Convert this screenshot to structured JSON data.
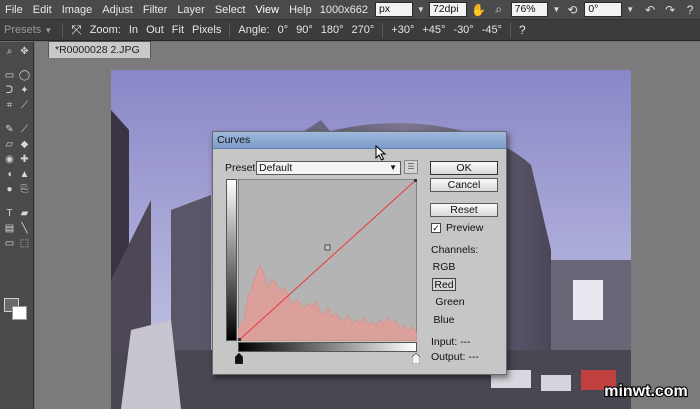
{
  "menu": [
    "File",
    "Edit",
    "Image",
    "Adjust",
    "Filter",
    "Layer",
    "Select",
    "View",
    "Help"
  ],
  "doc_size": "1000x662",
  "unit_field": "px",
  "resolution_field": "72dpi",
  "zoom_field": "76%",
  "angle_field": "0°",
  "options": {
    "presets_label": "Presets",
    "zoom_label": "Zoom:",
    "zoom_in": "In",
    "zoom_out": "Out",
    "zoom_fit": "Fit",
    "zoom_pixels": "Pixels",
    "angle_label": "Angle:",
    "angles": [
      "0°",
      "90°",
      "180°",
      "270°"
    ],
    "rotations": [
      "+30°",
      "+45°",
      "-30°",
      "-45°"
    ]
  },
  "document_tab": "*R0000028 2.JPG",
  "curves": {
    "title": "Curves",
    "preset_label": "Preset:",
    "preset_value": "Default",
    "ok_label": "OK",
    "cancel_label": "Cancel",
    "reset_label": "Reset",
    "preview_label": "Preview",
    "preview_checked": true,
    "channels_label": "Channels:",
    "channels": [
      "RGB",
      "Red",
      "Green",
      "Blue"
    ],
    "selected_channel": "Red",
    "input_label": "Input: ---",
    "output_label": "Output: ---",
    "curve_color": "#e83a3a",
    "histogram_color": "#e89a92"
  },
  "watermark_text": "minwt.com",
  "icons": [
    "hand-icon",
    "zoom-icon",
    "move-icon",
    "undo-icon",
    "redo-icon",
    "help-icon",
    "fit-icon"
  ]
}
